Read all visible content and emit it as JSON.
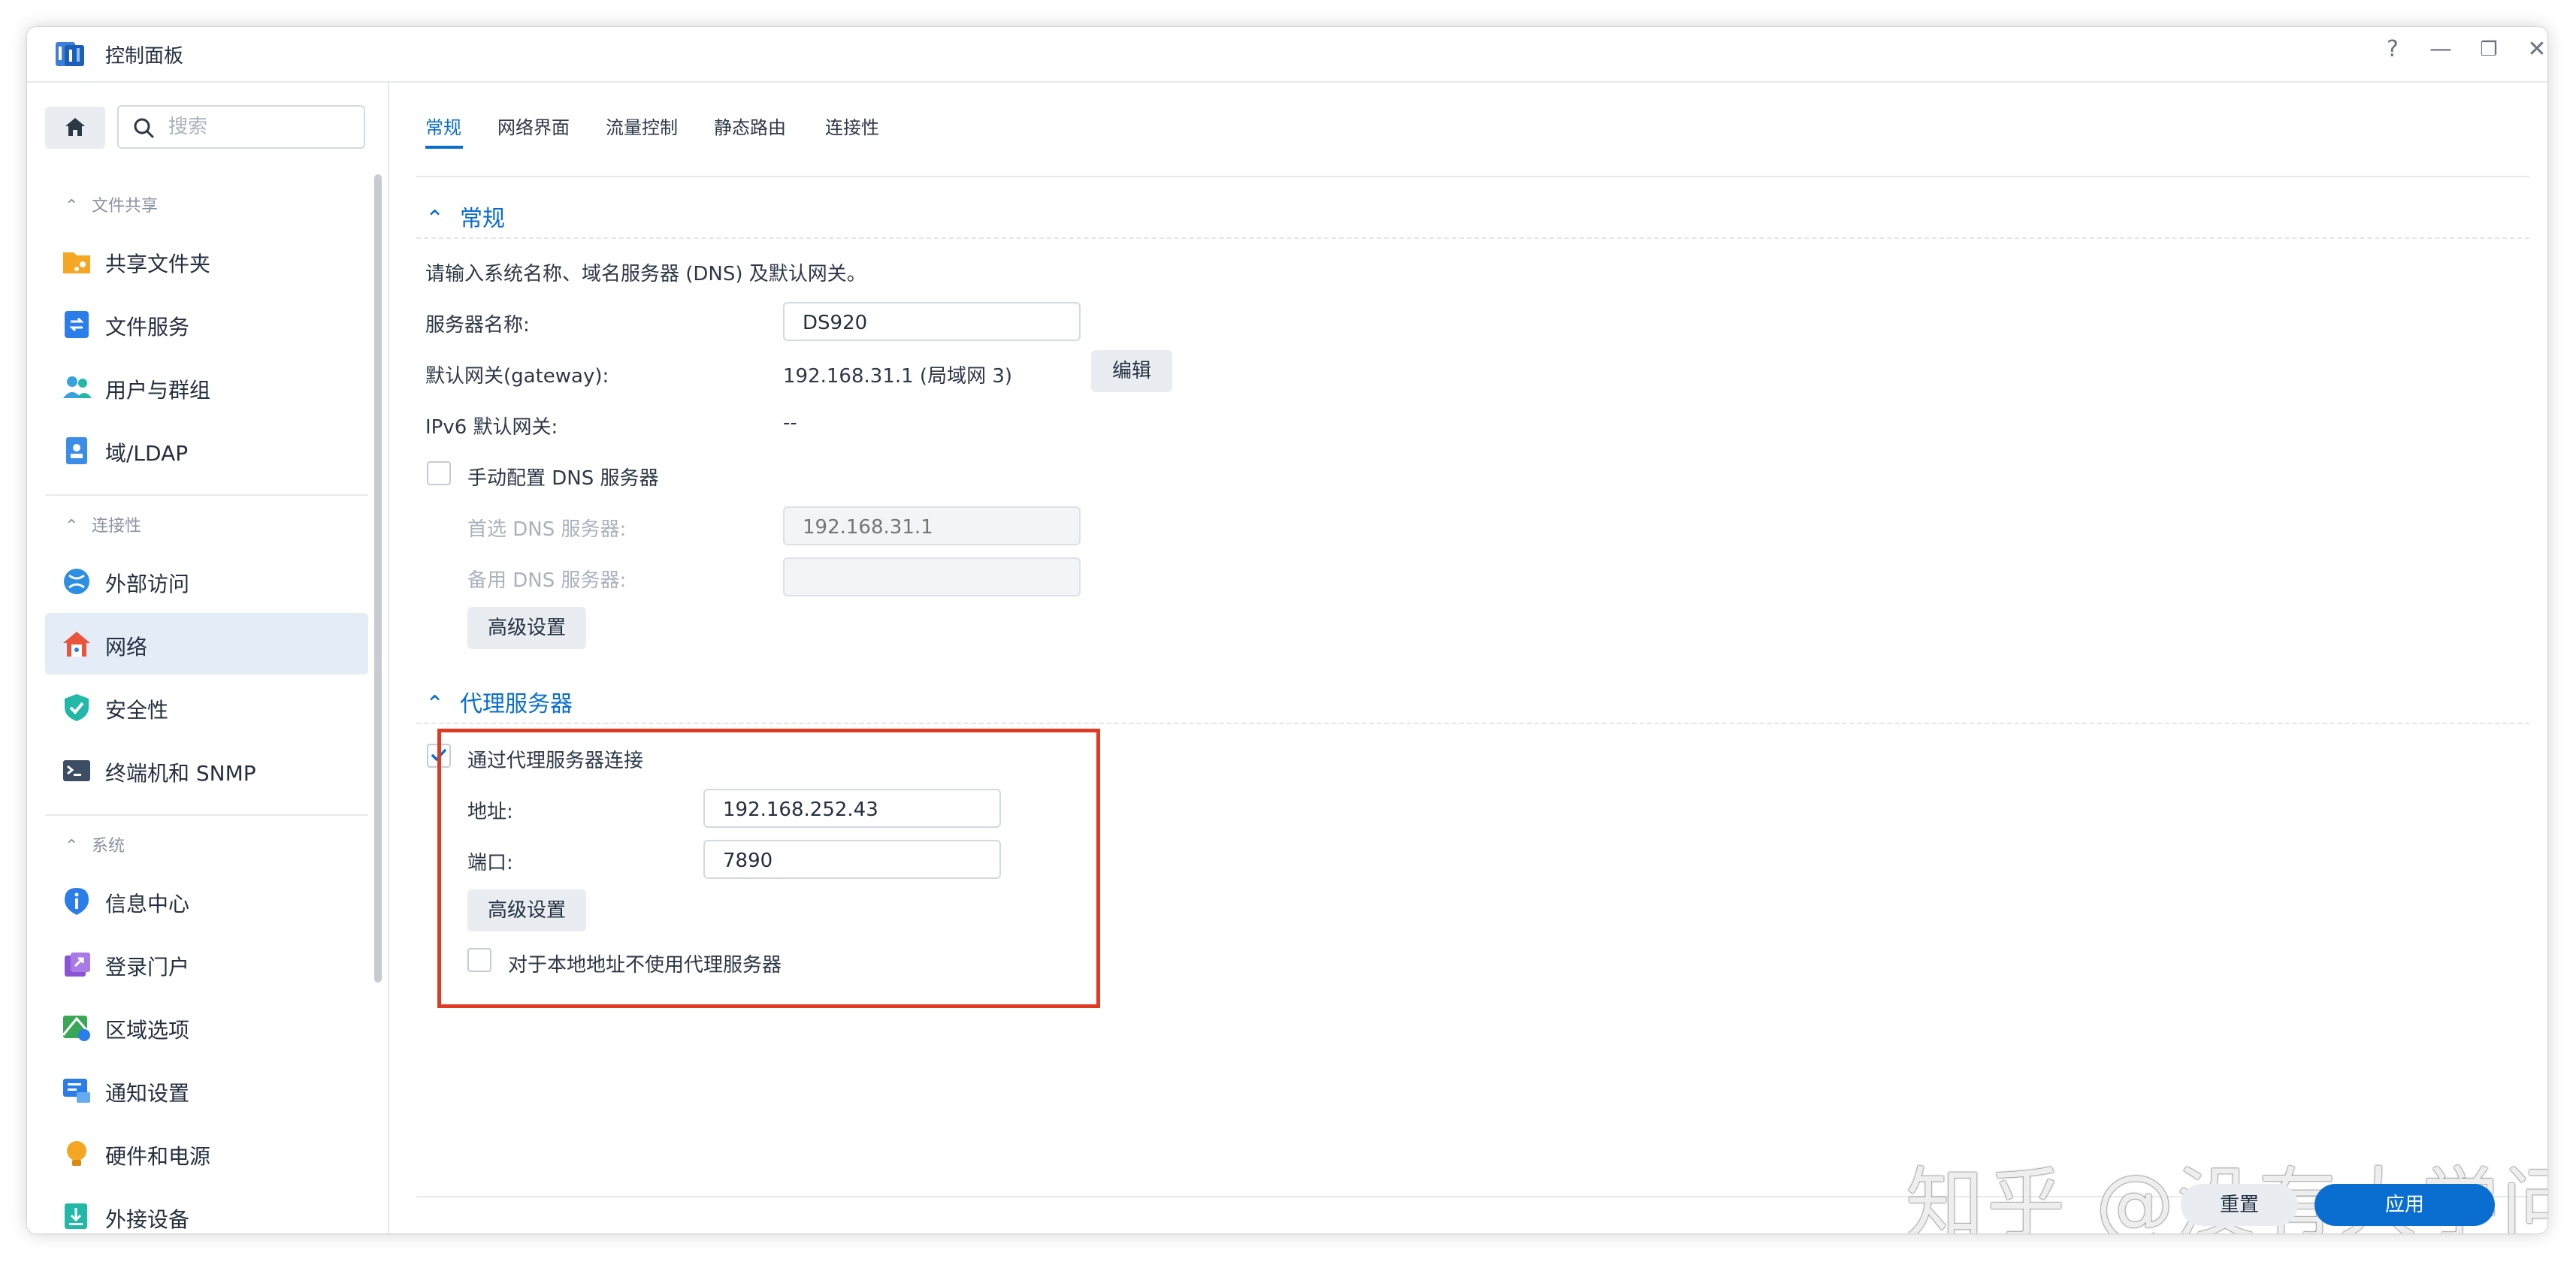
{
  "window": {
    "title": "控制面板",
    "controls": {
      "help": "?",
      "minimize": "—",
      "restore": "❐",
      "close": "✕"
    }
  },
  "sidebar": {
    "search_placeholder": "搜索",
    "groups": [
      {
        "label": "文件共享",
        "items": [
          {
            "label": "共享文件夹",
            "icon": "folder-share-icon",
            "color": "#f5a623"
          },
          {
            "label": "文件服务",
            "icon": "file-service-icon",
            "color": "#2b7de9"
          },
          {
            "label": "用户与群组",
            "icon": "users-icon",
            "color": "#36a3e0"
          },
          {
            "label": "域/LDAP",
            "icon": "ldap-icon",
            "color": "#3b8ee8"
          }
        ]
      },
      {
        "label": "连接性",
        "items": [
          {
            "label": "外部访问",
            "icon": "external-access-icon",
            "color": "#2d8fe3"
          },
          {
            "label": "网络",
            "icon": "network-house-icon",
            "color": "#e8543c",
            "active": true
          },
          {
            "label": "安全性",
            "icon": "shield-icon",
            "color": "#22b8a7"
          },
          {
            "label": "终端机和 SNMP",
            "icon": "terminal-icon",
            "color": "#3d4d63"
          }
        ]
      },
      {
        "label": "系统",
        "items": [
          {
            "label": "信息中心",
            "icon": "info-icon",
            "color": "#2b7de9"
          },
          {
            "label": "登录门户",
            "icon": "login-portal-icon",
            "color": "#8b53d6"
          },
          {
            "label": "区域选项",
            "icon": "region-icon",
            "color": "#3aa757"
          },
          {
            "label": "通知设置",
            "icon": "notification-icon",
            "color": "#2b7de9"
          },
          {
            "label": "硬件和电源",
            "icon": "bulb-icon",
            "color": "#f5a623"
          },
          {
            "label": "外接设备",
            "icon": "external-device-icon",
            "color": "#22b8a7"
          }
        ]
      }
    ]
  },
  "tabs": [
    "常规",
    "网络界面",
    "流量控制",
    "静态路由",
    "连接性"
  ],
  "general": {
    "section_title": "常规",
    "intro": "请输入系统名称、域名服务器 (DNS) 及默认网关。",
    "server_name_label": "服务器名称:",
    "server_name_value": "DS920",
    "gateway_label": "默认网关(gateway):",
    "gateway_value": "192.168.31.1 (局域网 3)",
    "edit_button": "编辑",
    "ipv6_label": "IPv6 默认网关:",
    "ipv6_value": "--",
    "manual_dns_label": "手动配置 DNS 服务器",
    "preferred_dns_label": "首选 DNS 服务器:",
    "preferred_dns_placeholder": "192.168.31.1",
    "alternate_dns_label": "备用 DNS 服务器:",
    "alternate_dns_value": "",
    "advanced_button": "高级设置"
  },
  "proxy": {
    "section_title": "代理服务器",
    "use_proxy_label": "通过代理服务器连接",
    "address_label": "地址:",
    "address_value": "192.168.252.43",
    "port_label": "端口:",
    "port_value": "7890",
    "advanced_button": "高级设置",
    "bypass_local_label": "对于本地地址不使用代理服务器"
  },
  "footer": {
    "reset_button": "重置",
    "apply_button": "应用"
  },
  "watermark": "知乎 @没有大学问",
  "colors": {
    "accent": "#0a6ed1",
    "highlight_box": "#e03a22"
  }
}
